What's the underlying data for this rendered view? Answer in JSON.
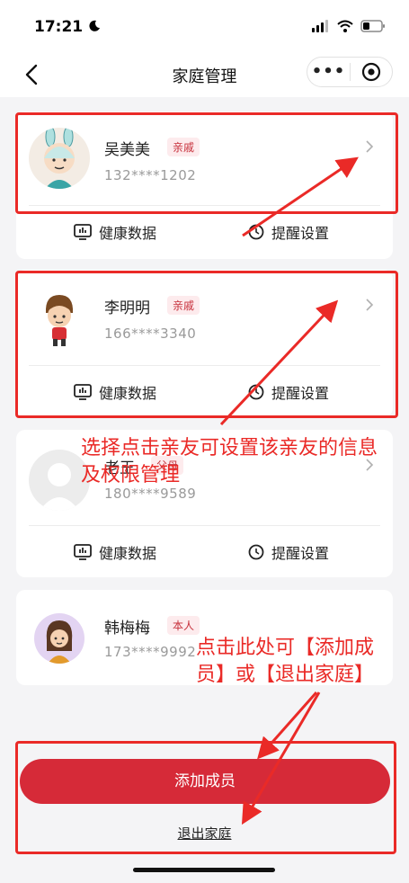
{
  "status_bar": {
    "time": "17:21"
  },
  "nav": {
    "title": "家庭管理",
    "menu_dots": "•••"
  },
  "members": [
    {
      "name": "吴美美",
      "tag": "亲戚",
      "phone": "132****1202"
    },
    {
      "name": "李明明",
      "tag": "亲戚",
      "phone": "166****3340"
    },
    {
      "name": "老王",
      "tag": "父母",
      "phone": "180****9589"
    },
    {
      "name": "韩梅梅",
      "tag": "本人",
      "phone": "173****9992"
    }
  ],
  "actions": {
    "health": "健康数据",
    "reminder": "提醒设置"
  },
  "buttons": {
    "add_member": "添加成员",
    "quit_family": "退出家庭"
  },
  "annotations": {
    "select_member": "选择点击亲友可设置该亲友的信息及权限管理",
    "add_or_quit": "点击此处可【添加成员】或【退出家庭】"
  },
  "colors": {
    "accent": "#d62a38",
    "annotation": "#ea2a27",
    "tag_text": "#c7303b",
    "tag_bg": "#fdebed"
  }
}
